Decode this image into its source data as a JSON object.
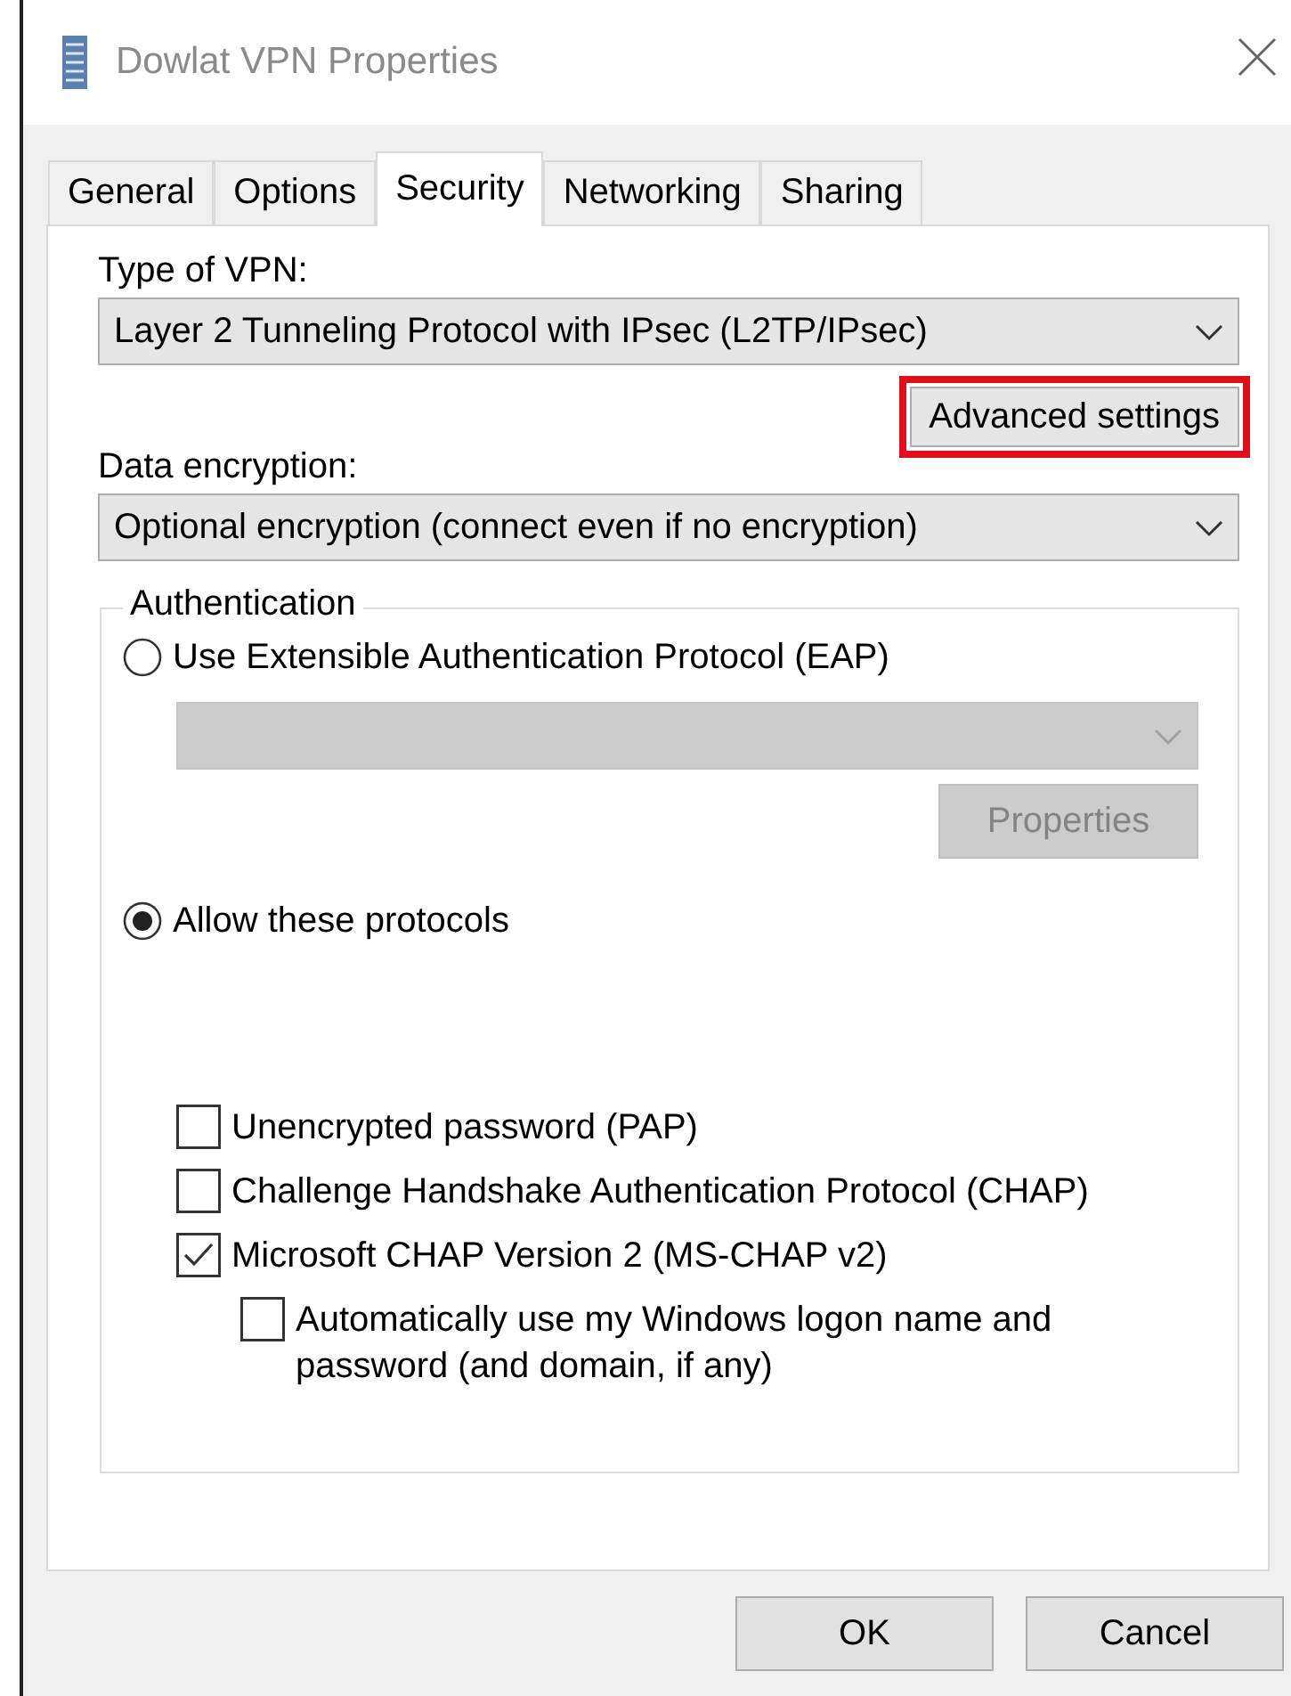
{
  "window": {
    "title": "Dowlat VPN Properties"
  },
  "tabs": [
    {
      "label": "General",
      "selected": false
    },
    {
      "label": "Options",
      "selected": false
    },
    {
      "label": "Security",
      "selected": true
    },
    {
      "label": "Networking",
      "selected": false
    },
    {
      "label": "Sharing",
      "selected": false
    }
  ],
  "vpn_type": {
    "label": "Type of VPN:",
    "value": "Layer 2 Tunneling Protocol with IPsec (L2TP/IPsec)"
  },
  "advanced_button": {
    "label": "Advanced settings",
    "highlighted": true
  },
  "encryption": {
    "label": "Data encryption:",
    "value": "Optional encryption (connect even if no encryption)"
  },
  "authentication": {
    "title": "Authentication",
    "options": [
      {
        "label": "Use Extensible Authentication Protocol (EAP)",
        "selected": false
      },
      {
        "label": "Allow these protocols",
        "selected": true
      }
    ],
    "eap_dropdown": {
      "disabled": true
    },
    "properties_button": {
      "label": "Properties",
      "disabled": true
    },
    "protocols": [
      {
        "label": "Unencrypted password (PAP)",
        "checked": false,
        "kind": "main"
      },
      {
        "label": "Challenge Handshake Authentication Protocol (CHAP)",
        "checked": false,
        "kind": "main"
      },
      {
        "label": "Microsoft CHAP Version 2 (MS-CHAP v2)",
        "checked": true,
        "kind": "main"
      },
      {
        "label": "Automatically use my Windows logon name and password (and domain, if any)",
        "checked": false,
        "kind": "sub"
      }
    ]
  },
  "buttons": [
    "OK",
    "Cancel"
  ]
}
